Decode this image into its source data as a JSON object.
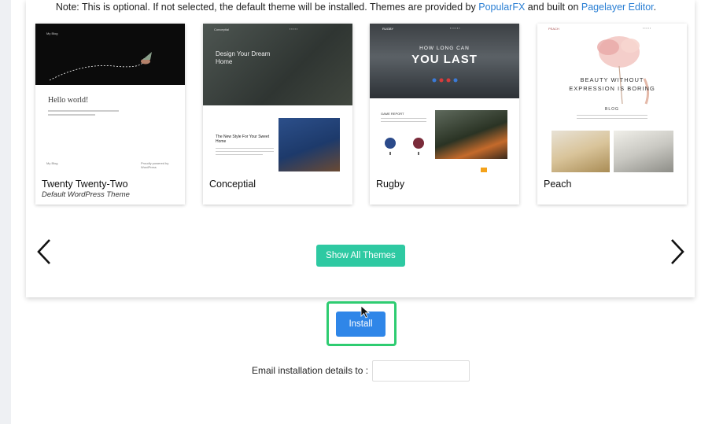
{
  "note": {
    "prefix": "Note: This is optional. If not selected, the default theme will be installed. Themes are provided by ",
    "link1": "PopularFX",
    "middle": " and built on ",
    "link2": "Pagelayer Editor",
    "suffix": "."
  },
  "themes": [
    {
      "name": "Twenty Twenty-Two",
      "subtitle": "Default WordPress Theme",
      "thumb": {
        "hello": "Hello world!",
        "site": "My Blog",
        "footer": "Proudly powered by WordPress"
      }
    },
    {
      "name": "Conceptial",
      "subtitle": "",
      "thumb": {
        "headline": "Design Your Dream Home",
        "body_title": "The New Style For Your Sweet Home",
        "brand": "Conceptial"
      }
    },
    {
      "name": "Rugby",
      "subtitle": "",
      "thumb": {
        "small": "HOW LONG CAN",
        "big": "YOU LAST",
        "report": "GAME REPORT",
        "brand": "RUGBY"
      }
    },
    {
      "name": "Peach",
      "subtitle": "",
      "thumb": {
        "headline": "BEAUTY WITHOUT EXPRESSION IS BORING",
        "blog": "BLOG",
        "brand": "PEACH"
      }
    }
  ],
  "buttons": {
    "show_all": "Show All Themes",
    "install": "Install"
  },
  "email": {
    "label": "Email installation details to :",
    "value": "",
    "placeholder": ""
  },
  "icons": {
    "prev": "chevron-left-icon",
    "next": "chevron-right-icon",
    "cursor": "mouse-pointer-icon"
  },
  "colors": {
    "link": "#2a7fd4",
    "show_all_bg": "#2ec9a2",
    "install_bg": "#2f86e8",
    "highlight": "#2ecc71"
  }
}
